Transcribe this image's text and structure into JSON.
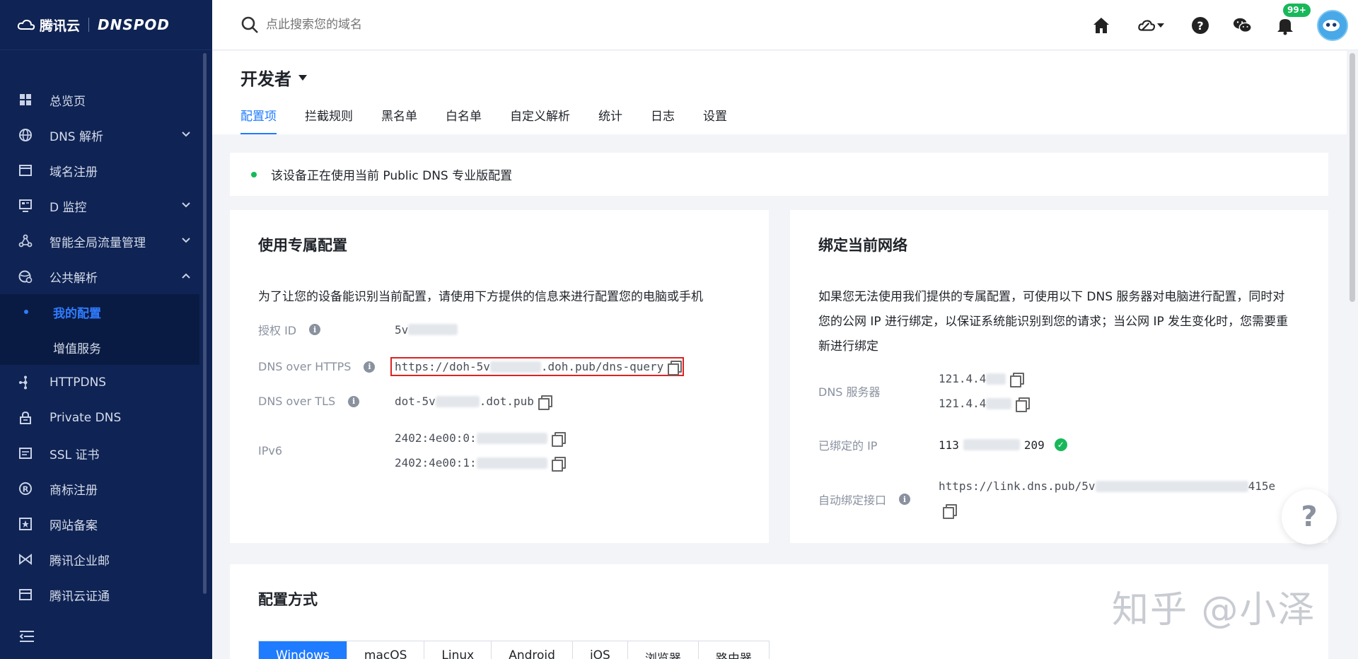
{
  "brand": {
    "name": "腾讯云",
    "product": "DNSPOD"
  },
  "search": {
    "placeholder": "点此搜索您的域名"
  },
  "notifications": {
    "badge": "99+"
  },
  "sidebar": {
    "items": [
      {
        "label": "总览页",
        "icon": "dashboard-icon"
      },
      {
        "label": "DNS 解析",
        "icon": "globe-icon"
      },
      {
        "label": "域名注册",
        "icon": "calendar-icon"
      },
      {
        "label": "D 监控",
        "icon": "monitor-icon"
      },
      {
        "label": "智能全局流量管理",
        "icon": "network-icon"
      },
      {
        "label": "公共解析",
        "icon": "public-dns-icon"
      }
    ],
    "sub_items": [
      {
        "label": "我的配置"
      },
      {
        "label": "增值服务"
      }
    ],
    "items_after": [
      {
        "label": "HTTPDNS",
        "icon": "httpdns-icon"
      },
      {
        "label": "Private DNS",
        "icon": "lock-icon"
      },
      {
        "label": "SSL 证书",
        "icon": "certificate-icon"
      },
      {
        "label": "商标注册",
        "icon": "trademark-icon"
      },
      {
        "label": "网站备案",
        "icon": "filing-icon"
      },
      {
        "label": "腾讯企业邮",
        "icon": "mail-icon"
      },
      {
        "label": "腾讯云证通",
        "icon": "id-icon"
      }
    ]
  },
  "header": {
    "title": "开发者",
    "tabs": [
      "配置项",
      "拦截规则",
      "黑名单",
      "白名单",
      "自定义解析",
      "统计",
      "日志",
      "设置"
    ]
  },
  "status": {
    "text": "该设备正在使用当前 Public DNS 专业版配置"
  },
  "config_card": {
    "title": "使用专属配置",
    "desc": "为了让您的设备能识别当前配置，请使用下方提供的信息来进行配置您的电脑或手机",
    "auth_label": "授权 ID",
    "auth_value": "5v",
    "doh_label": "DNS over HTTPS",
    "doh_prefix": "https://doh-5v",
    "doh_suffix": ".doh.pub/dns-query",
    "dot_label": "DNS over TLS",
    "dot_prefix": "dot-5v",
    "dot_suffix": ".dot.pub",
    "ipv6_label": "IPv6",
    "ipv6_1": "2402:4e00:0:",
    "ipv6_2": "2402:4e00:1:"
  },
  "bind_card": {
    "title": "绑定当前网络",
    "desc_1": "如果您无法使用我们提供的专属配置，可使用以下 DNS 服务器对电脑进行配置，同时对",
    "desc_2": "您的公网 IP 进行绑定，以保证系统能识别到您的请求；当公网 IP 发生变化时，您需要重",
    "desc_3": "新进行绑定",
    "dns_label": "DNS 服务器",
    "dns_1": "121.4.4",
    "dns_2": "121.4.4",
    "bound_label": "已绑定的 IP",
    "bound_prefix": "113",
    "bound_suffix": "209",
    "auto_label": "自动绑定接口",
    "auto_prefix": "https://link.dns.pub/5v",
    "auto_suffix": "415e"
  },
  "method_card": {
    "title": "配置方式",
    "tabs": [
      "Windows",
      "macOS",
      "Linux",
      "Android",
      "iOS",
      "浏览器",
      "路由器"
    ]
  },
  "watermark": "知乎 @小泽",
  "help": "?"
}
